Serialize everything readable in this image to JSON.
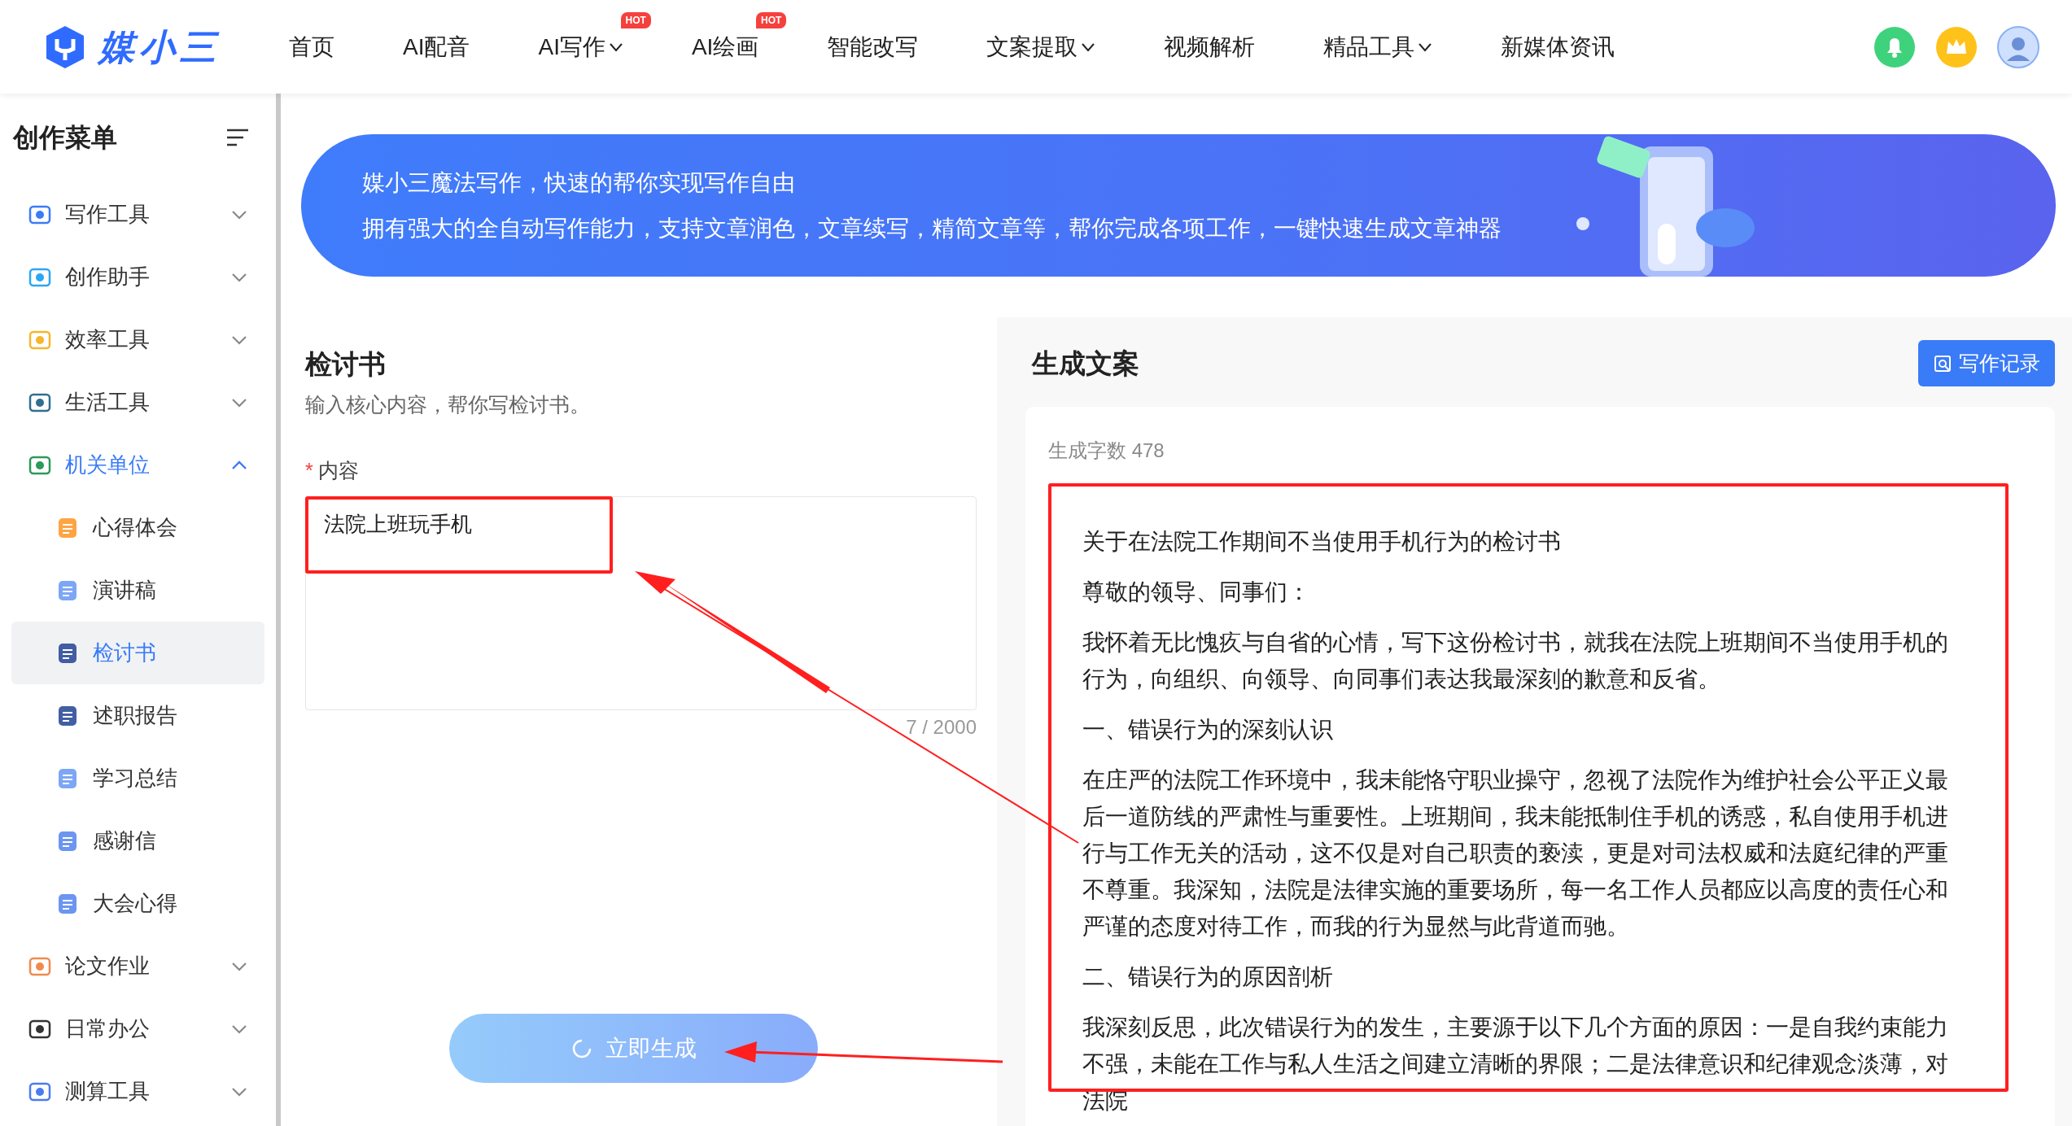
{
  "logo": {
    "text": "媒小三"
  },
  "nav": [
    {
      "label": "首页",
      "dropdown": false
    },
    {
      "label": "AI配音",
      "dropdown": false
    },
    {
      "label": "AI写作",
      "badge": "HOT",
      "dropdown": true
    },
    {
      "label": "AI绘画",
      "badge": "HOT",
      "dropdown": false
    },
    {
      "label": "智能改写",
      "dropdown": false
    },
    {
      "label": "文案提取",
      "dropdown": true
    },
    {
      "label": "视频解析",
      "dropdown": false
    },
    {
      "label": "精品工具",
      "dropdown": true
    },
    {
      "label": "新媒体资讯",
      "dropdown": false
    }
  ],
  "sidebar": {
    "title": "创作菜单",
    "items": [
      {
        "label": "写作工具",
        "expanded": false,
        "selected": false
      },
      {
        "label": "创作助手",
        "expanded": false,
        "selected": false
      },
      {
        "label": "效率工具",
        "expanded": false,
        "selected": false
      },
      {
        "label": "生活工具",
        "expanded": false,
        "selected": false
      },
      {
        "label": "机关单位",
        "expanded": true,
        "selected": false,
        "children": [
          {
            "label": "心得体会",
            "selected": false
          },
          {
            "label": "演讲稿",
            "selected": false
          },
          {
            "label": "检讨书",
            "selected": true
          },
          {
            "label": "述职报告",
            "selected": false
          },
          {
            "label": "学习总结",
            "selected": false
          },
          {
            "label": "感谢信",
            "selected": false
          },
          {
            "label": "大会心得",
            "selected": false
          }
        ]
      },
      {
        "label": "论文作业",
        "expanded": false,
        "selected": false
      },
      {
        "label": "日常办公",
        "expanded": false,
        "selected": false
      },
      {
        "label": "测算工具",
        "expanded": false,
        "selected": false
      }
    ]
  },
  "banner": {
    "lines": [
      "媒小三魔法写作，快速的帮你实现写作自由",
      "拥有强大的全自动写作能力，支持文章润色，文章续写，精简文章等，帮你完成各项工作，一键快速生成文章神器"
    ]
  },
  "form": {
    "title": "检讨书",
    "subtitle": "输入核心内容，帮你写检讨书。",
    "field": {
      "required_mark": "*",
      "label": "内容",
      "value": "法院上班玩手机",
      "counter": "7 / 2000"
    },
    "button": {
      "label": "立即生成",
      "loading": true
    }
  },
  "result": {
    "title": "生成文案",
    "history_button": "写作记录",
    "count": "生成字数 478",
    "paragraphs": [
      "关于在法院工作期间不当使用手机行为的检讨书",
      "尊敬的领导、同事们：",
      "我怀着无比愧疚与自省的心情，写下这份检讨书，就我在法院上班期间不当使用手机的行为，向组织、向领导、向同事们表达我最深刻的歉意和反省。",
      "一、错误行为的深刻认识",
      "在庄严的法院工作环境中，我未能恪守职业操守，忽视了法院作为维护社会公平正义最后一道防线的严肃性与重要性。上班期间，我未能抵制住手机的诱惑，私自使用手机进行与工作无关的活动，这不仅是对自己职责的亵渎，更是对司法权威和法庭纪律的严重不尊重。我深知，法院是法律实施的重要场所，每一名工作人员都应以高度的责任心和严谨的态度对待工作，而我的行为显然与此背道而驰。",
      "二、错误行为的原因剖析",
      "我深刻反思，此次错误行为的发生，主要源于以下几个方面的原因：一是自我约束能力不强，未能在工作与私人生活之间建立清晰的界限；二是法律意识和纪律观念淡薄，对法院"
    ]
  }
}
